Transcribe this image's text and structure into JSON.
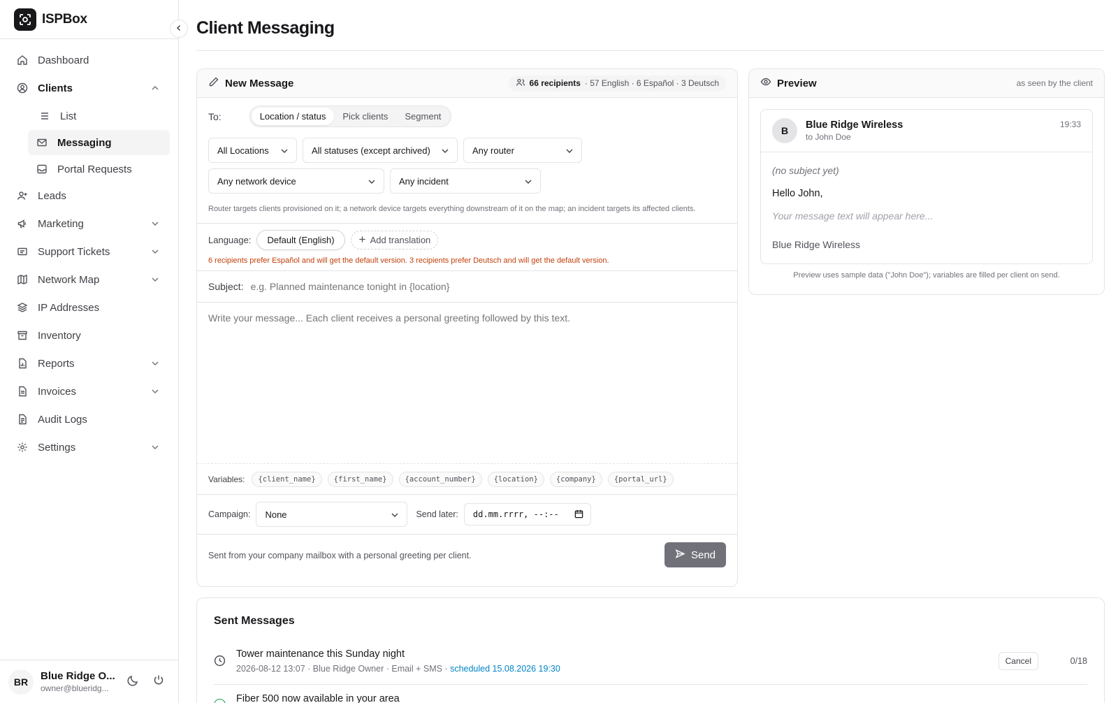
{
  "brand": {
    "name": "ISPBox"
  },
  "nav": {
    "dashboard": "Dashboard",
    "clients": "Clients",
    "clients_list": "List",
    "clients_messaging": "Messaging",
    "clients_portal": "Portal Requests",
    "leads": "Leads",
    "marketing": "Marketing",
    "support": "Support Tickets",
    "network_map": "Network Map",
    "ip_addresses": "IP Addresses",
    "inventory": "Inventory",
    "reports": "Reports",
    "invoices": "Invoices",
    "audit_logs": "Audit Logs",
    "settings": "Settings"
  },
  "user": {
    "initials": "BR",
    "name": "Blue Ridge O...",
    "email": "owner@blueridg..."
  },
  "page": {
    "title": "Client Messaging"
  },
  "composer": {
    "title": "New Message",
    "recipients_count": "66 recipients",
    "recipients_breakdown": "· 57 English · 6 Español · 3 Deutsch",
    "to_label": "To:",
    "to_tabs": [
      "Location / status",
      "Pick clients",
      "Segment"
    ],
    "filters": {
      "location": "All Locations",
      "status": "All statuses (except archived)",
      "router": "Any router",
      "network_device": "Any network device",
      "incident": "Any incident"
    },
    "filter_hint": "Router targets clients provisioned on it; a network device targets everything downstream of it on the map; an incident targets its affected clients.",
    "language_label": "Language:",
    "language_default": "Default (English)",
    "add_translation": "Add translation",
    "language_warning": "6 recipients prefer Español and will get the default version. 3 recipients prefer Deutsch and will get the default version.",
    "subject_label": "Subject:",
    "subject_placeholder": "e.g. Planned maintenance tonight in {location}",
    "body_placeholder": "Write your message... Each client receives a personal greeting followed by this text.",
    "variables_label": "Variables:",
    "variables": [
      "{client_name}",
      "{first_name}",
      "{account_number}",
      "{location}",
      "{company}",
      "{portal_url}"
    ],
    "campaign_label": "Campaign:",
    "campaign_value": "None",
    "send_later_label": "Send later:",
    "send_later_value": "dd.mm.rrrr, --:--",
    "footer_note": "Sent from your company mailbox with a personal greeting per client.",
    "send_button": "Send"
  },
  "preview": {
    "title": "Preview",
    "subtitle": "as seen by the client",
    "sender_initial": "B",
    "sender": "Blue Ridge Wireless",
    "recipient": "to John Doe",
    "time": "19:33",
    "subject": "(no subject yet)",
    "greeting": "Hello John,",
    "body": "Your message text will appear here...",
    "signature": "Blue Ridge Wireless",
    "note": "Preview uses sample data (\"John Doe\"); variables are filled per client on send."
  },
  "sent": {
    "title": "Sent Messages",
    "items": [
      {
        "title": "Tower maintenance this Sunday night",
        "meta": "2026-08-12 13:07 · Blue Ridge Owner · Email + SMS ·",
        "scheduled": "scheduled 15.08.2026 19:30",
        "action": "Cancel",
        "count": "0/18"
      },
      {
        "title": "Fiber 500 now available in your area"
      }
    ]
  },
  "colors": {
    "accent": "#0284c7",
    "warning": "#c2410c",
    "send_disabled": "#71717a"
  }
}
